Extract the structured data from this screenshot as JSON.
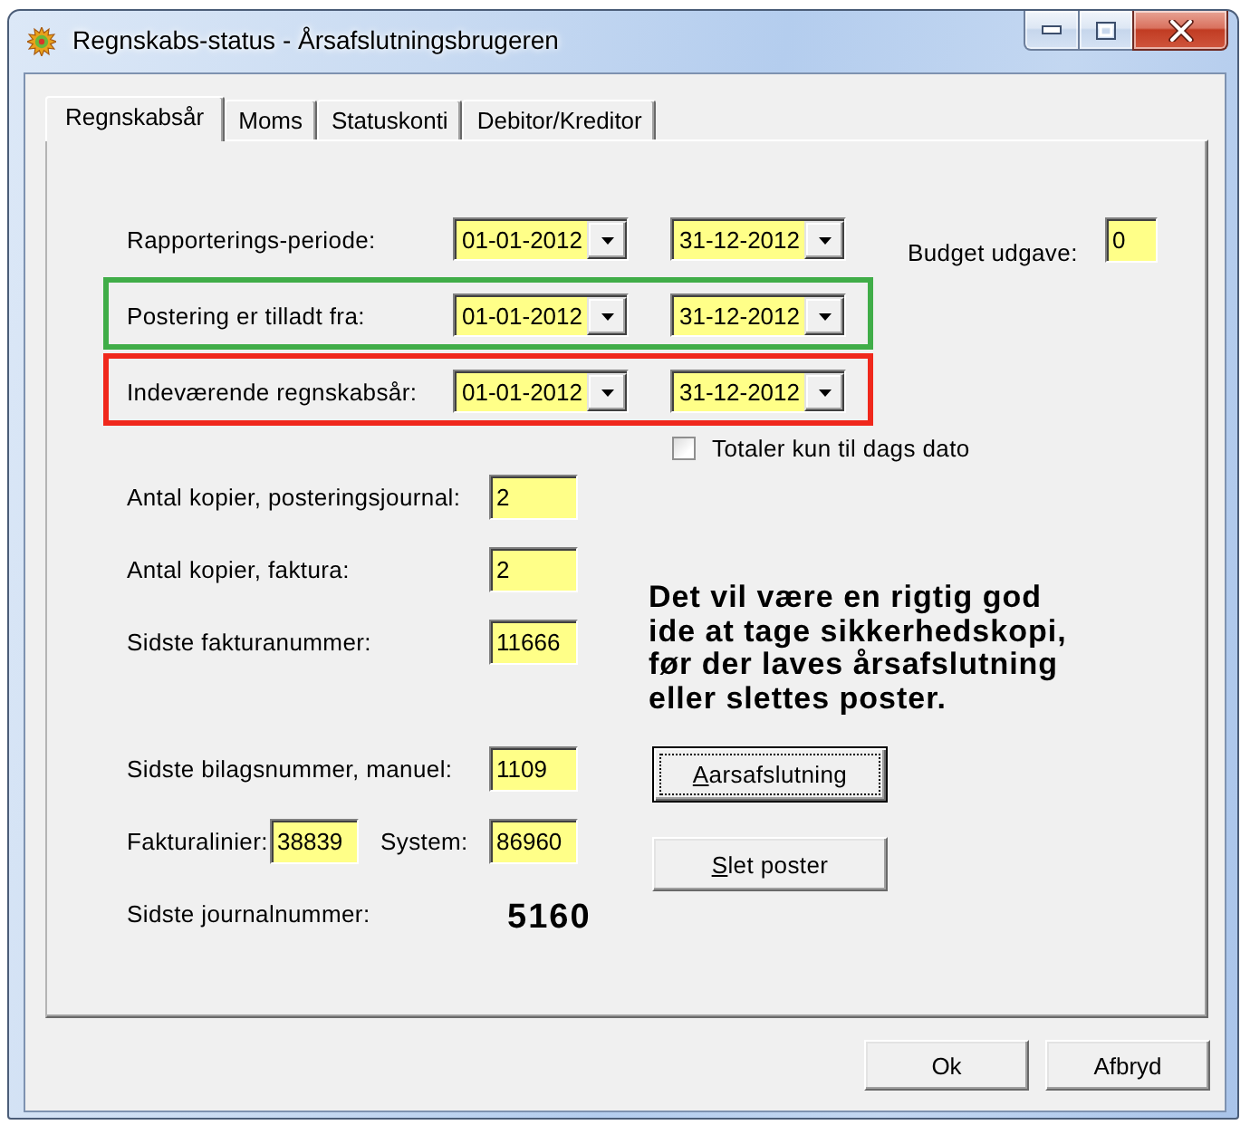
{
  "window": {
    "title": "Regnskabs-status - Årsafslutningsbrugeren"
  },
  "tabs": [
    {
      "label": "Regnskabsår",
      "selected": true
    },
    {
      "label": "Moms",
      "selected": false
    },
    {
      "label": "Statuskonti",
      "selected": false
    },
    {
      "label": "Debitor/Kreditor",
      "selected": false
    }
  ],
  "date_rows": [
    {
      "label": "Rapporterings-periode:",
      "from": "01-01-2012",
      "to": "31-12-2012"
    },
    {
      "label": "Postering er tilladt fra:",
      "from": "01-01-2012",
      "to": "31-12-2012",
      "color": "#40ad48"
    },
    {
      "label": "Indeværende regnskabsår:",
      "from": "01-01-2012",
      "to": "31-12-2012",
      "color": "#f0281c"
    }
  ],
  "budget": {
    "label": "Budget udgave:",
    "value": "0"
  },
  "totals_checkbox": {
    "label": "Totaler kun til dags dato",
    "checked": false
  },
  "field_groups": [
    {
      "fields": [
        {
          "label": "Antal kopier, posteringsjournal:",
          "value": "2"
        },
        {
          "label": "Antal kopier, faktura:",
          "value": "2"
        },
        {
          "label": "Sidste fakturanummer:",
          "value": "11666"
        }
      ]
    },
    {
      "fields": [
        {
          "label": "Sidste bilagsnummer, manuel:",
          "value": "1109"
        }
      ]
    }
  ],
  "invoice_lines": {
    "label": "Fakturalinier:",
    "value": "38839",
    "system_label": "System:",
    "system_value": "86960"
  },
  "journal": {
    "label": "Sidste journalnummer:",
    "value": "5160"
  },
  "warning": "Det vil være en rigtig god\nide at tage sikkerhedskopi,\nfør der laves årsafslutning\neller slettes poster.",
  "actions": [
    {
      "label": "Aarsafslutning",
      "focused": true,
      "underline_first_letter": true
    },
    {
      "label": "Slet poster",
      "focused": false,
      "underline_first_letter": true
    }
  ],
  "dialog_buttons": [
    {
      "label": "Ok"
    },
    {
      "label": "Afbryd"
    }
  ]
}
